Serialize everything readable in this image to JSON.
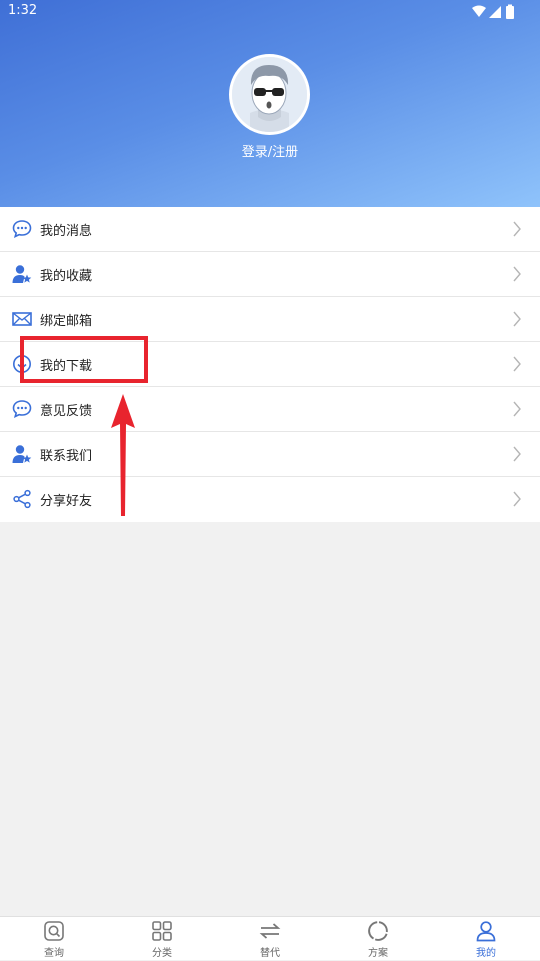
{
  "status_bar": {
    "time": "1:32"
  },
  "profile": {
    "login_label": "登录/注册"
  },
  "menu": {
    "items": [
      {
        "label": "我的消息",
        "icon": "message-icon"
      },
      {
        "label": "我的收藏",
        "icon": "user-star-icon"
      },
      {
        "label": "绑定邮箱",
        "icon": "mail-icon"
      },
      {
        "label": "我的下载",
        "icon": "download-icon"
      },
      {
        "label": "意见反馈",
        "icon": "message-icon"
      },
      {
        "label": "联系我们",
        "icon": "user-star-icon"
      },
      {
        "label": "分享好友",
        "icon": "share-icon"
      }
    ]
  },
  "tabbar": {
    "tabs": [
      {
        "label": "查询",
        "icon": "search-icon"
      },
      {
        "label": "分类",
        "icon": "grid-icon"
      },
      {
        "label": "替代",
        "icon": "swap-icon"
      },
      {
        "label": "方案",
        "icon": "circle-icon"
      },
      {
        "label": "我的",
        "icon": "person-icon"
      }
    ],
    "active_index": 4
  },
  "colors": {
    "accent": "#3a6fd8",
    "highlight": "#e8242e",
    "header_start": "#3f6fd6",
    "header_end": "#8fc3fb"
  }
}
